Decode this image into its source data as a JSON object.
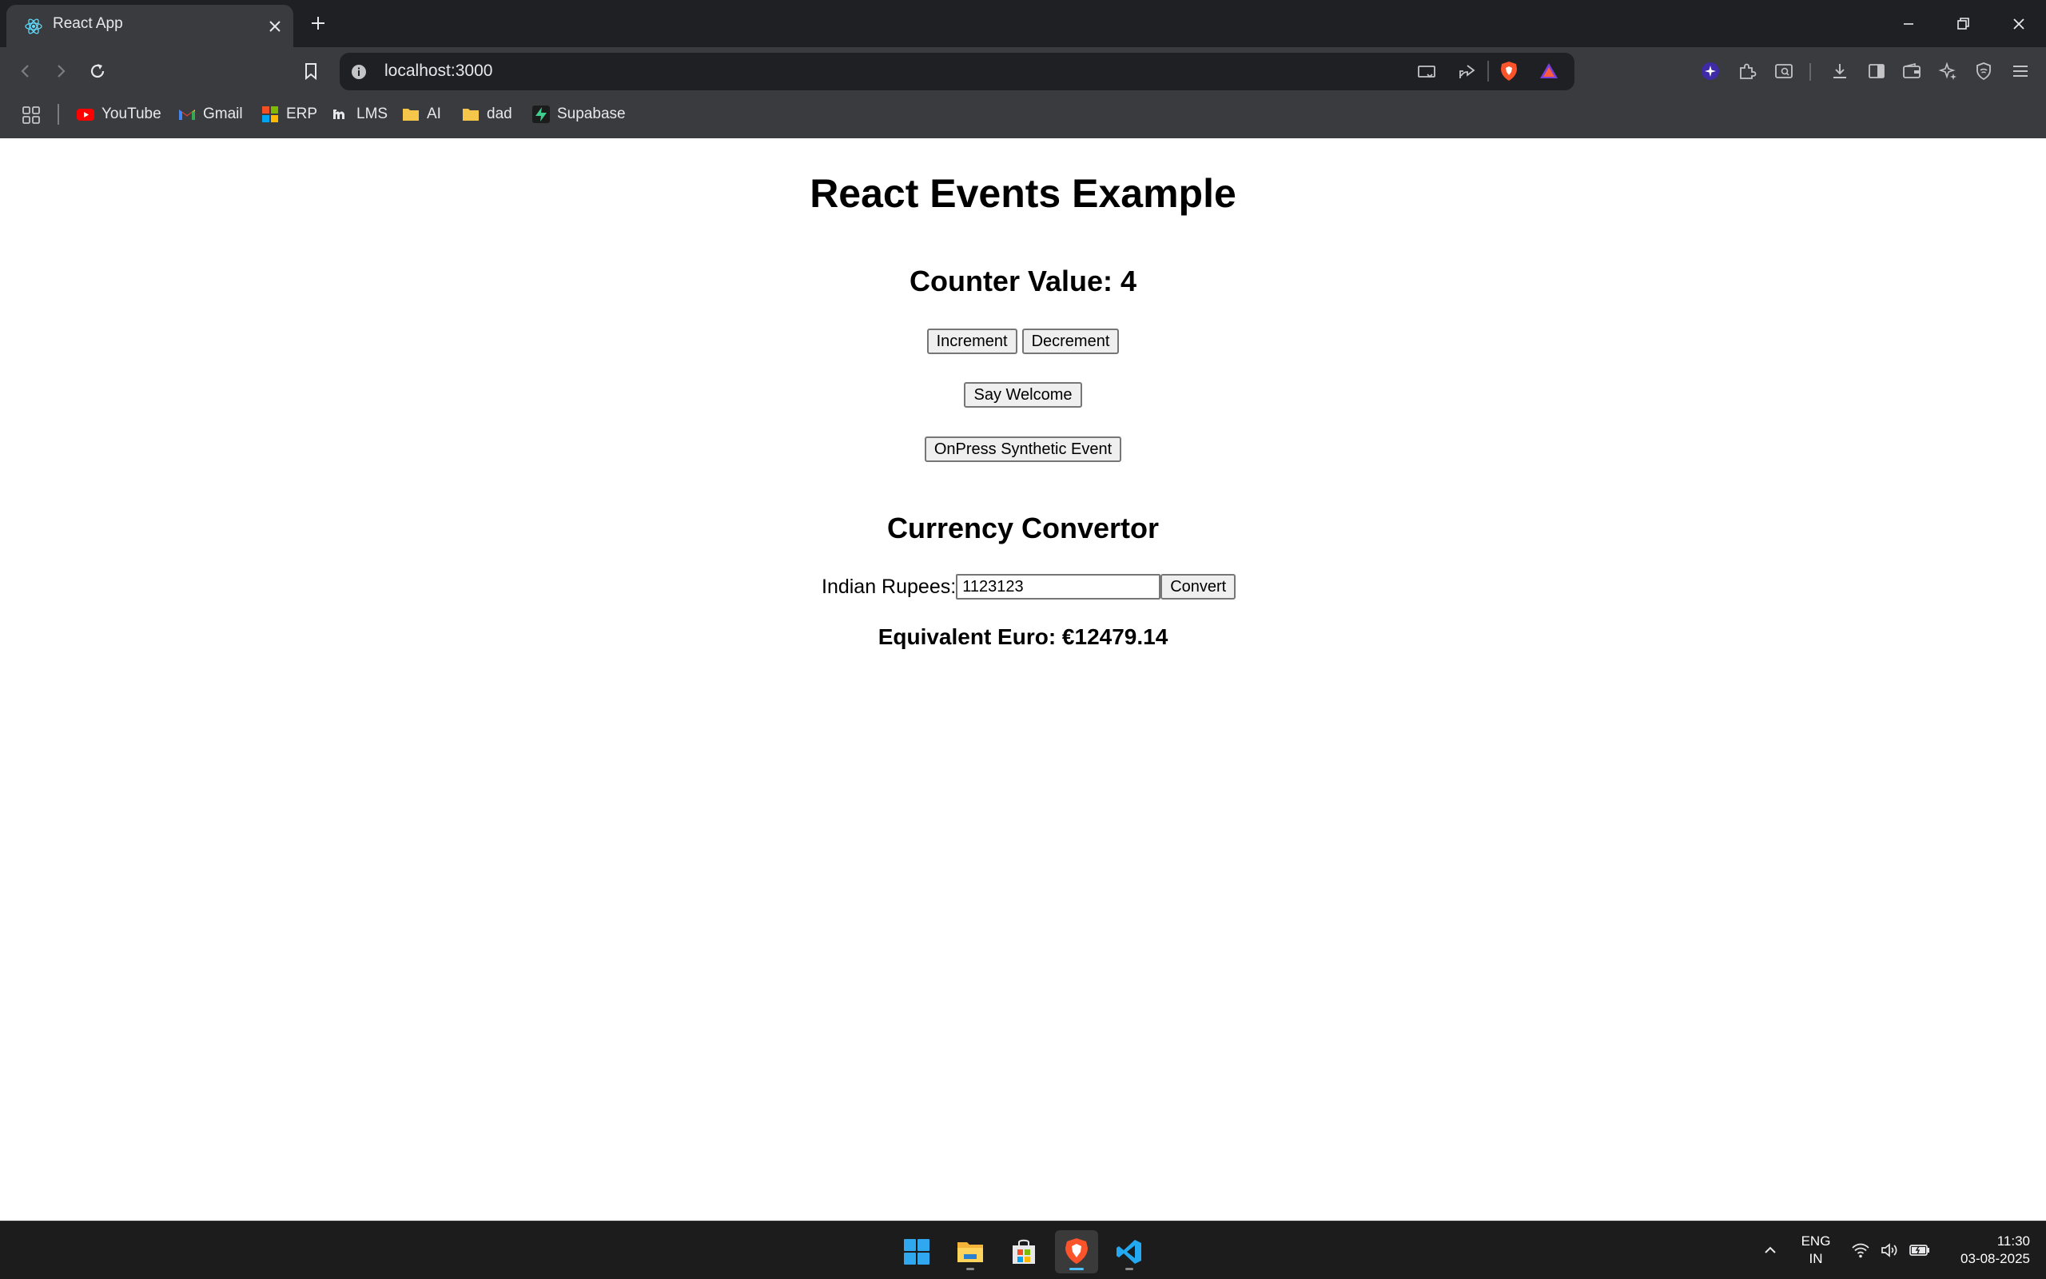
{
  "browser": {
    "tab": {
      "title": "React App"
    },
    "address_bar": {
      "url": "localhost:3000"
    },
    "bookmarks": [
      {
        "label": "YouTube",
        "icon": "youtube-icon"
      },
      {
        "label": "Gmail",
        "icon": "gmail-icon"
      },
      {
        "label": "ERP",
        "icon": "erp-icon"
      },
      {
        "label": "LMS",
        "icon": "lms-icon"
      },
      {
        "label": "AI",
        "icon": "folder-icon"
      },
      {
        "label": "dad",
        "icon": "folder-icon"
      },
      {
        "label": "Supabase",
        "icon": "supabase-icon"
      }
    ]
  },
  "page": {
    "title": "React Events Example",
    "counter": {
      "heading": "Counter Value: 4",
      "increment_label": "Increment",
      "decrement_label": "Decrement"
    },
    "welcome_label": "Say Welcome",
    "synthetic_label": "OnPress Synthetic Event",
    "converter": {
      "heading": "Currency Convertor",
      "input_label": "Indian Rupees:",
      "input_value": "1123123",
      "convert_label": "Convert",
      "result": "Equivalent Euro: €12479.14"
    }
  },
  "taskbar": {
    "apps": [
      "windows-start-icon",
      "file-explorer-icon",
      "microsoft-store-icon",
      "brave-browser-icon",
      "vscode-icon"
    ],
    "language": {
      "line1": "ENG",
      "line2": "IN"
    },
    "time": "11:30",
    "date": "03-08-2025"
  },
  "colors": {
    "chrome_dark": "#1f2023",
    "chrome_mid": "#3a3b3e",
    "brave_orange": "#fb542b",
    "taskbar": "#1c1c1c"
  }
}
